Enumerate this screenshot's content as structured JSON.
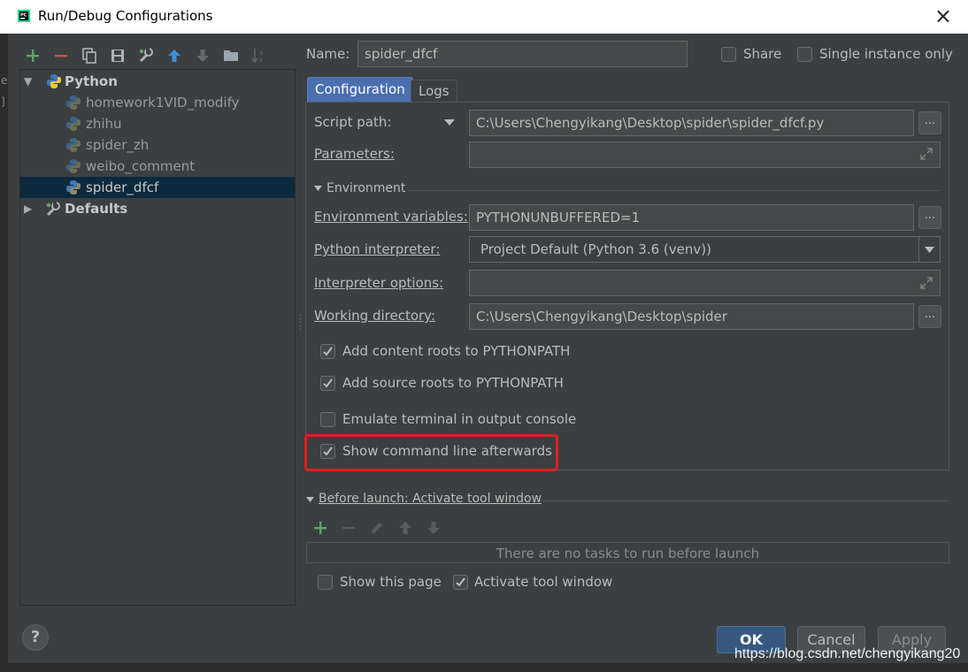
{
  "window": {
    "title": "Run/Debug Configurations",
    "close_icon": "×",
    "edge_glyphs": [
      "e",
      "]"
    ]
  },
  "tree": {
    "groups": [
      {
        "label": "Python",
        "expanded": true,
        "children": [
          "homework1VID_modify",
          "zhihu",
          "spider_zh",
          "weibo_comment",
          "spider_dfcf"
        ],
        "selected": "spider_dfcf"
      },
      {
        "label": "Defaults",
        "expanded": false
      }
    ]
  },
  "header": {
    "name_label": "Name:",
    "name_value": "spider_dfcf",
    "share_label": "Share",
    "single_instance_label": "Single instance only"
  },
  "tabs": [
    "Configuration",
    "Logs"
  ],
  "config": {
    "script_path_label": "Script path:",
    "script_path_value": "C:\\Users\\Chengyikang\\Desktop\\spider\\spider_dfcf.py",
    "parameters_label": "Parameters:",
    "parameters_value": "",
    "environment_header": "Environment",
    "env_vars_label": "Environment variables:",
    "env_vars_value": "PYTHONUNBUFFERED=1",
    "interpreter_label": "Python interpreter:",
    "interpreter_value": "Project Default (Python 3.6 (venv))",
    "interp_options_label": "Interpreter options:",
    "interp_options_value": "",
    "working_dir_label": "Working directory:",
    "working_dir_value": "C:\\Users\\Chengyikang\\Desktop\\spider",
    "browse_label": "...",
    "checkboxes": [
      {
        "label": "Add content roots to PYTHONPATH",
        "checked": true
      },
      {
        "label": "Add source roots to PYTHONPATH",
        "checked": true
      },
      {
        "label": "Emulate terminal in output console",
        "checked": false
      },
      {
        "label": "Show command line afterwards",
        "checked": true
      }
    ]
  },
  "before_launch": {
    "header": "Before launch: Activate tool window",
    "empty_text": "There are no tasks to run before launch",
    "show_page_label": "Show this page",
    "show_page_checked": false,
    "activate_tool_label": "Activate tool window",
    "activate_tool_checked": true
  },
  "buttons": {
    "ok": "OK",
    "cancel": "Cancel",
    "apply": "Apply",
    "help": "?"
  },
  "watermark": "https://blog.csdn.net/chengyikang20",
  "colors": {
    "accent": "#4b6eaf",
    "selection": "#0d293e",
    "highlight": "#e02020",
    "add_green": "#59a869",
    "remove_red": "#c75450"
  }
}
